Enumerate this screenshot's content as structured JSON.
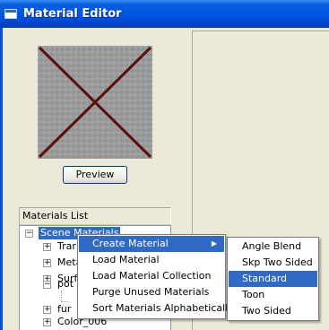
{
  "window": {
    "title": "Material Editor"
  },
  "preview": {
    "button_label": "Preview"
  },
  "materials_list": {
    "header": "Materials List",
    "tree": [
      {
        "label": "Scene Materials",
        "expander": "−",
        "selected": true
      },
      {
        "label": "Trar",
        "expander": "+"
      },
      {
        "label": "Meta",
        "expander": "+"
      },
      {
        "label": "Surf",
        "expander": "+"
      },
      {
        "label": "pot",
        "expander": "−"
      },
      {
        "label": "",
        "expander": ""
      },
      {
        "label": "fur",
        "expander": "+"
      },
      {
        "label": "Color_006",
        "expander": "+"
      }
    ]
  },
  "context_menu": {
    "items": [
      {
        "label": "Create Material",
        "has_submenu": true,
        "highlighted": true
      },
      {
        "label": "Load Material"
      },
      {
        "label": "Load Material Collection"
      },
      {
        "label": "Purge Unused Materials"
      },
      {
        "label": "Sort Materials Alphabetically"
      }
    ],
    "submenu_arrow": "▶"
  },
  "submenu": {
    "items": [
      {
        "label": "Angle Blend"
      },
      {
        "label": "Skp Two Sided"
      },
      {
        "label": "Standard",
        "highlighted": true
      },
      {
        "label": "Toon"
      },
      {
        "label": "Two Sided"
      }
    ]
  },
  "colors": {
    "title_bar": "#0055E5",
    "highlight": "#316AC5",
    "preview_cross": "#5A0E0E",
    "preview_background": "#9C9C9C"
  }
}
